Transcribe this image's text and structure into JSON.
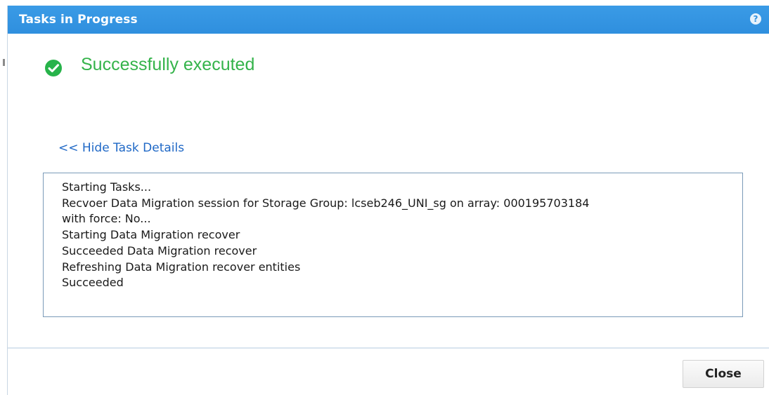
{
  "dialog": {
    "title": "Tasks in Progress",
    "help_icon": "?"
  },
  "status": {
    "icon": "check-circle-icon",
    "text": "Successfully executed",
    "color": "#34b34a"
  },
  "details": {
    "toggle_label": "<< Hide Task Details",
    "lines": [
      "Starting Tasks...",
      "Recvoer Data Migration session for Storage Group: lcseb246_UNI_sg on array: 000195703184",
      "with force: No...",
      "Starting Data Migration recover",
      "Succeeded Data Migration recover",
      "Refreshing Data Migration recover entities",
      "Succeeded"
    ]
  },
  "footer": {
    "close_label": "Close"
  },
  "colors": {
    "titlebar": "#2f8fde",
    "link": "#1f68c6",
    "box_border": "#7a9ab8"
  }
}
